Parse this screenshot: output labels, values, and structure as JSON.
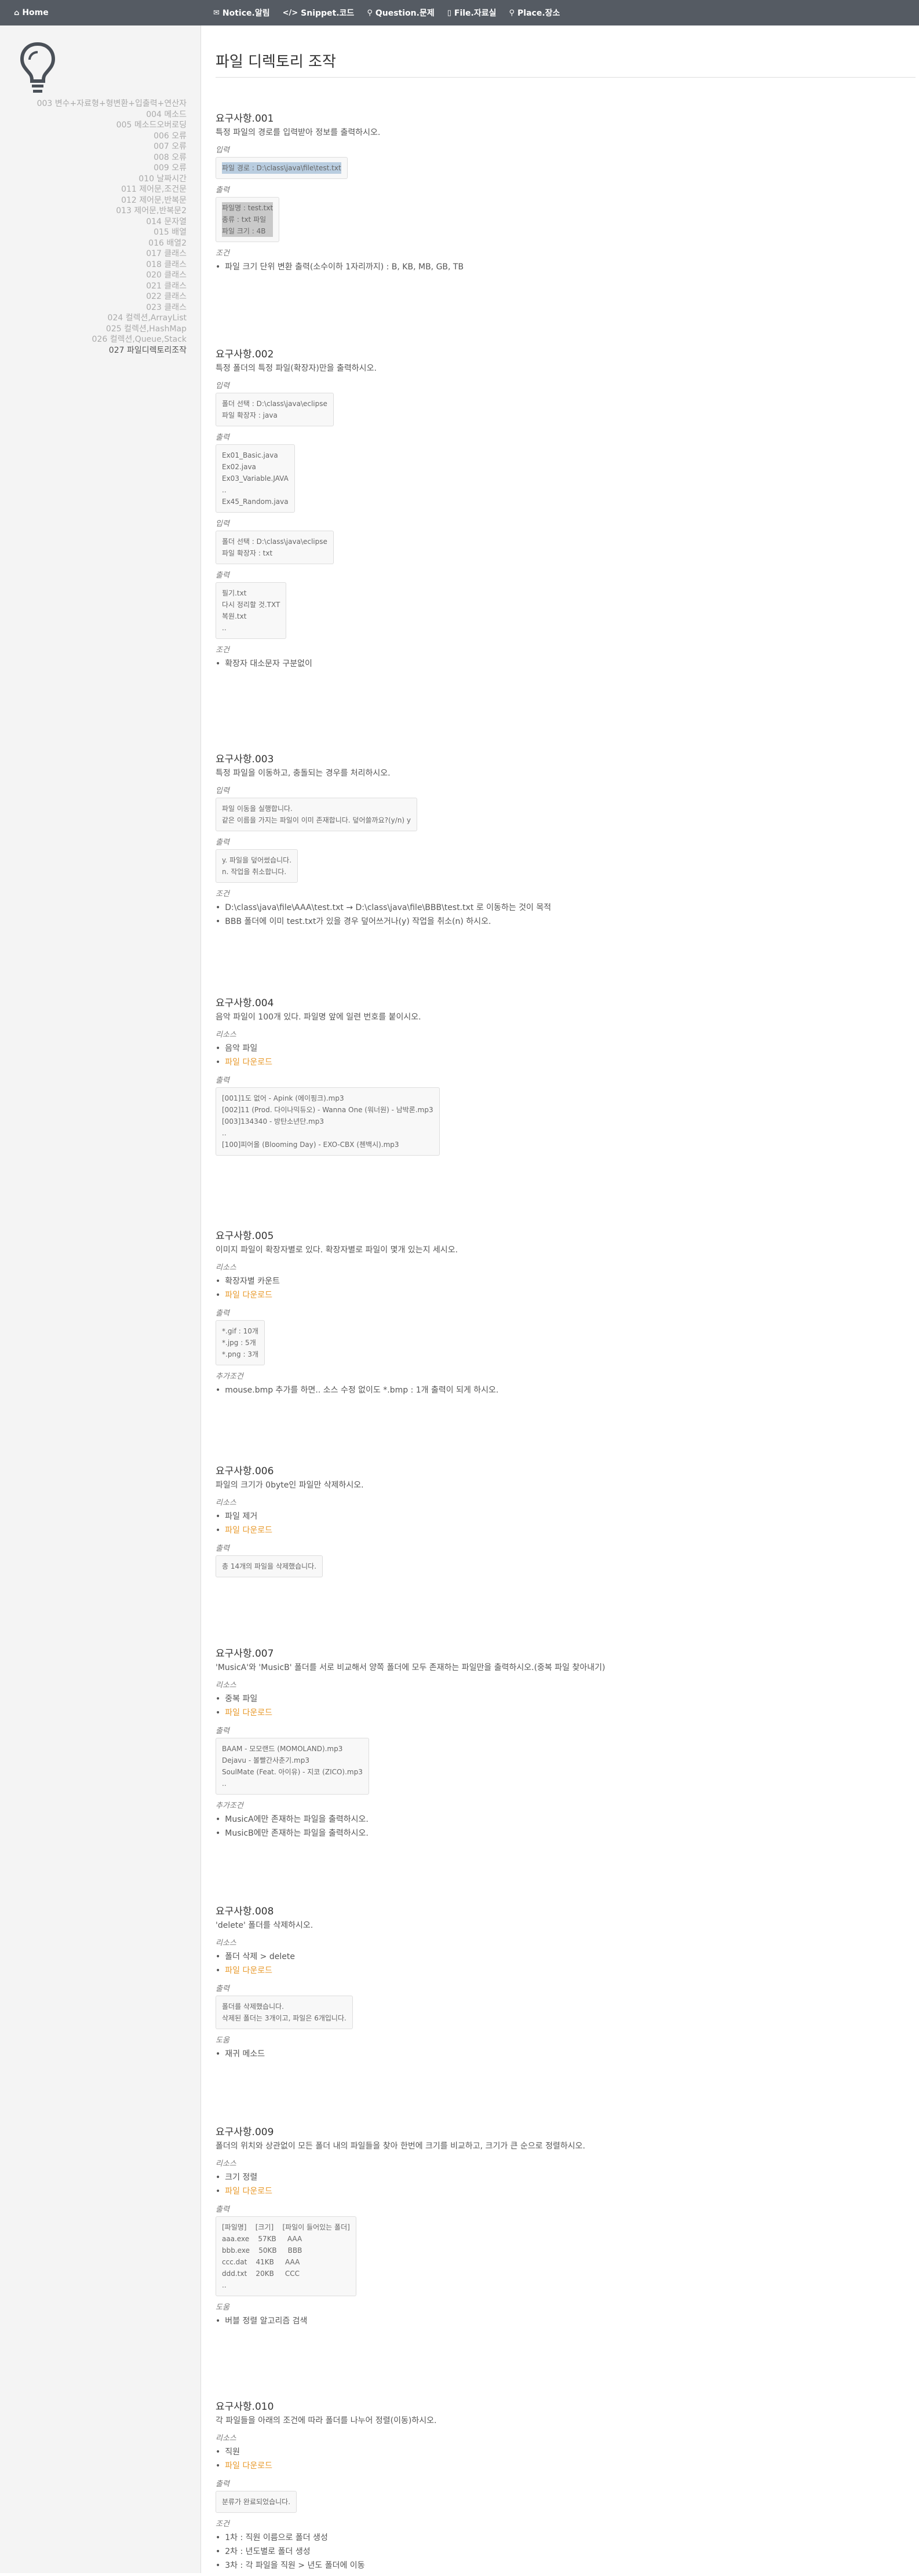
{
  "nav": {
    "home": "Home",
    "items": [
      {
        "label": "Notice.알림",
        "icon": "bullhorn-icon",
        "glyph": "✉"
      },
      {
        "label": "Snippet.코드",
        "icon": "code-icon",
        "glyph": "</>"
      },
      {
        "label": "Question.문제",
        "icon": "map-marker-icon",
        "glyph": "⚲"
      },
      {
        "label": "File.자료실",
        "icon": "file-icon",
        "glyph": "▯"
      },
      {
        "label": "Place.장소",
        "icon": "map-marker-icon",
        "glyph": "⚲"
      }
    ]
  },
  "sidebar": {
    "items": [
      "003 변수+자료형+형변환+입출력+연산자",
      "004 메소드",
      "005 메소드오버로딩",
      "006 오류",
      "007 오류",
      "008 오류",
      "009 오류",
      "010 날짜시간",
      "011 제어문,조건문",
      "012 제어문,반복문",
      "013 제어문,반복문2",
      "014 문자열",
      "015 배열",
      "016 배열2",
      "017 클래스",
      "018 클래스",
      "020 클래스",
      "021 클래스",
      "022 클래스",
      "023 클래스",
      "024 컬렉션,ArrayList",
      "025 컬렉션,HashMap",
      "026 컬렉션,Queue,Stack",
      "027 파일디렉토리조작"
    ],
    "active_index": 23
  },
  "page_title": "파일 디렉토리 조작",
  "sections": [
    {
      "title": "요구사항.001",
      "desc": "특정 파일의 경로를 입력받아 정보를 출력하시오.",
      "input_label": "입력",
      "input_lines": [
        "파일 경로 : D:\\class\\java\\file\\test.txt"
      ],
      "output_label": "출력",
      "output_lines": [
        "파일명 : test.txt",
        "종류 : txt 파일",
        "파일 크기 : 4B"
      ],
      "cond_label": "조건",
      "conds": [
        "파일 크기 단위 변환 출력(소수이하 1자리까지) : B, KB, MB, GB, TB"
      ]
    },
    {
      "title": "요구사항.002",
      "desc": "특정 폴더의 특정 파일(확장자)만을 출력하시오.",
      "input_label": "입력",
      "input1": [
        "폴더 선택 : D:\\class\\java\\eclipse",
        "파일 확장자 : java"
      ],
      "output_label": "출력",
      "output1": [
        "Ex01_Basic.java",
        "Ex02.java",
        "Ex03_Variable.JAVA",
        "..",
        "Ex45_Random.java"
      ],
      "input2": [
        "폴더 선택 : D:\\class\\java\\eclipse",
        "파일 확장자 : txt"
      ],
      "output2": [
        "필기.txt",
        "다시 정리할 것.TXT",
        "복원.txt",
        ".."
      ],
      "cond_label": "조건",
      "conds": [
        "확장자 대소문자 구분없이"
      ]
    },
    {
      "title": "요구사항.003",
      "desc": "특정 파일을 이동하고, 충돌되는 경우를 처리하시오.",
      "input_label": "입력",
      "input_lines": [
        "파일 이동을 실행합니다.",
        "같은 이름을 가지는 파일이 이미 존재합니다. 덮어쓸까요?(y/n) y"
      ],
      "output_label": "출력",
      "output_lines": [
        "y. 파일을 덮어썼습니다.",
        "n. 작업을 취소합니다."
      ],
      "cond_label": "조건",
      "conds": [
        "D:\\class\\java\\file\\AAA\\test.txt → D:\\class\\java\\file\\BBB\\test.txt 로 이동하는 것이 목적",
        "BBB 폴더에 이미 test.txt가 있을 경우 덮어쓰거나(y) 작업을 취소(n) 하시오."
      ]
    },
    {
      "title": "요구사항.004",
      "desc": "음악 파일이 100개 있다. 파일명 앞에 일련 번호를 붙이시오.",
      "res_label": "리소스",
      "res": [
        "음악 파일"
      ],
      "download": "파일 다운로드",
      "output_label": "출력",
      "output_lines": [
        "[001]1도 없어 - Apink (에이핑크).mp3",
        "[002]11 (Prod. 다이나믹듀오) - Wanna One (워너원) - 남박론.mp3",
        "[003]134340 - 방탄소년단.mp3",
        "..",
        "[100]피어올 (Blooming Day) - EXO-CBX (첸백시).mp3"
      ]
    },
    {
      "title": "요구사항.005",
      "desc": "이미지 파일이 확장자별로 있다. 확장자별로 파일이 몇개 있는지 세시오.",
      "res_label": "리소스",
      "res": [
        "확장자별 카운트"
      ],
      "download": "파일 다운로드",
      "output_label": "출력",
      "output_lines": [
        "*.gif : 10개",
        "*.jpg : 5개",
        "*.png : 3개"
      ],
      "extra_label": "추가조건",
      "extras": [
        "mouse.bmp 추가를 하면.. 소스 수정 없이도 *.bmp : 1개 출력이 되게 하시오."
      ]
    },
    {
      "title": "요구사항.006",
      "desc": "파일의 크기가 0byte인 파일만 삭제하시오.",
      "res_label": "리소스",
      "res": [
        "파일 제거"
      ],
      "download": "파일 다운로드",
      "output_label": "출력",
      "output_lines": [
        "총 14개의 파일을 삭제했습니다."
      ]
    },
    {
      "title": "요구사항.007",
      "desc": "'MusicA'와 'MusicB' 폴더를 서로 비교해서 양쪽 폴더에 모두 존재하는 파일만을 출력하시오.(중복 파일 찾아내기)",
      "res_label": "리소스",
      "res": [
        "중복 파일"
      ],
      "download": "파일 다운로드",
      "output_label": "출력",
      "output_lines": [
        "BAAM - 모모랜드 (MOMOLAND).mp3",
        "Dejavu - 볼빨간사춘기.mp3",
        "SoulMate (Feat. 아이유) - 지코 (ZICO).mp3",
        ".."
      ],
      "extra_label": "추가조건",
      "extras": [
        "MusicA에만 존재하는 파일을 출력하시오.",
        "MusicB에만 존재하는 파일을 출력하시오."
      ]
    },
    {
      "title": "요구사항.008",
      "desc": "'delete' 폴더를 삭제하시오.",
      "res_label": "리소스",
      "res": [
        "폴더 삭제 > delete"
      ],
      "download": "파일 다운로드",
      "output_label": "출력",
      "output_lines": [
        "폴더를 삭제했습니다.",
        "삭제된 폴더는 3개이고, 파일은 6개입니다."
      ],
      "hint_label": "도움",
      "hints": [
        "재귀 메소드"
      ]
    },
    {
      "title": "요구사항.009",
      "desc": "폴더의 위치와 상관없이 모든 폴더 내의 파일들을 찾아 한번에 크기를 비교하고, 크기가 큰 순으로 정렬하시오.",
      "res_label": "리소스",
      "res": [
        "크기 정렬"
      ],
      "download": "파일 다운로드",
      "output_label": "출력",
      "output_lines": [
        "[파일명]    [크기]    [파일이 들어있는 폴더]",
        "aaa.exe    57KB     AAA",
        "bbb.exe    50KB     BBB",
        "ccc.dat    41KB     AAA",
        "ddd.txt    20KB     CCC",
        ".."
      ],
      "hint_label": "도움",
      "hints": [
        "버블 정렬 알고리즘 검색"
      ]
    },
    {
      "title": "요구사항.010",
      "desc": "각 파일들을 아래의 조건에 따라 폴더를 나누어 정렬(이동)하시오.",
      "res_label": "리소스",
      "res": [
        "직원"
      ],
      "download": "파일 다운로드",
      "output_label": "출력",
      "output_lines": [
        "분류가 완료되었습니다."
      ],
      "cond_label": "조건",
      "conds": [
        "1차 : 직원 이름으로 폴더 생성",
        "2차 : 년도별로 폴더 생성",
        "3차 : 각 파일을 직원 > 년도 폴더에 이동"
      ]
    }
  ]
}
